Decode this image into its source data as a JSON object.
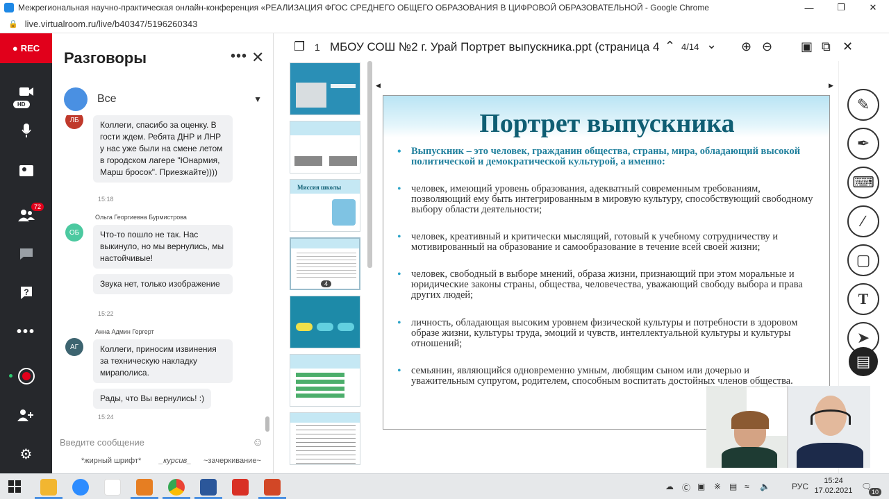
{
  "browser": {
    "title": "Межрегиональная научно-практическая онлайн-конференция «РЕАЛИЗАЦИЯ ФГОС СРЕДНЕГО ОБЩЕГО ОБРАЗОВАНИЯ В ЦИФРОВОЙ ОБРАЗОВАТЕЛЬНОЙ - Google Chrome",
    "url": "live.virtualroom.ru/live/b40347/5196260343"
  },
  "rail": {
    "rec_label": "REC",
    "hd_label": "HD",
    "participants_count": "72"
  },
  "chat": {
    "title": "Разговоры",
    "recipient": "Все",
    "messages": [
      {
        "initials": "ЛБ",
        "color": "#c0392b",
        "name": "",
        "texts": [
          "Коллеги, спасибо за оценку. В гости ждем. Ребята ДНР и ЛНР у нас уже были на смене летом в городском лагере \"Юнармия, Марш бросок\". Приезжайте))))"
        ],
        "time": "15:18"
      },
      {
        "initials": "ОБ",
        "color": "#4cc9a0",
        "name": "Ольга Георгиевна Бурмистрова",
        "texts": [
          "Что-то пошло не так. Нас выкинуло, но мы вернулись, мы настойчивые!",
          "Звука нет, только изображение"
        ],
        "time": "15:22"
      },
      {
        "initials": "АГ",
        "color": "#3d6470",
        "name": "Анна Админ Гергерт",
        "texts": [
          "Коллеги, приносим извинения за техническую накладку мираполиса.",
          "Рады, что Вы вернулись! :)"
        ],
        "time": "15:24"
      }
    ],
    "input_placeholder": "Введите сообщение",
    "format_bold": "*жирный шрифт*",
    "format_italic": "_курсив_",
    "format_strike": "~зачеркивание~"
  },
  "presentation": {
    "doc_index": "1",
    "doc_title": "МБОУ СОШ №2 г. Урай Портрет выпускника.ppt (страница 4",
    "page_counter": "4/14",
    "current_thumb_label": "4",
    "slide": {
      "title": "Портрет выпускника",
      "lead": "Выпускник – это человек, гражданин общества, страны, мира, обладающий высокой политической и демократической культурой, а именно:",
      "items": [
        "человек, имеющий уровень образования, адекватный современным требованиям, позволяющий ему быть интегрированным в мировую культуру, способствующий свободному выбору области деятельности;",
        "человек, креативный и критически мыслящий, готовый к учебному сотрудничеству и мотивированный на образование и самообразование в течение всей своей жизни;",
        " человек, свободный в выборе мнений, образа жизни, признающий при этом моральные и юридические законы страны, общества, человечества, уважающий свободу выбора и права других людей;",
        "личность,  обладающая высоким уровнем физической культуры и потребности в здоровом образе жизни, культуры труда, эмоций и чувств, интеллектуальной культуры и культуры отношений;",
        "семьянин, являющийся одновременно умным, любящим сыном или дочерью и уважительным супругом, родителем, способным воспитать достойных членов общества."
      ]
    },
    "thumb3_title": "Миссия школы"
  },
  "taskbar": {
    "lang": "РУС",
    "time": "15:24",
    "date": "17.02.2021",
    "notifications": "10"
  }
}
